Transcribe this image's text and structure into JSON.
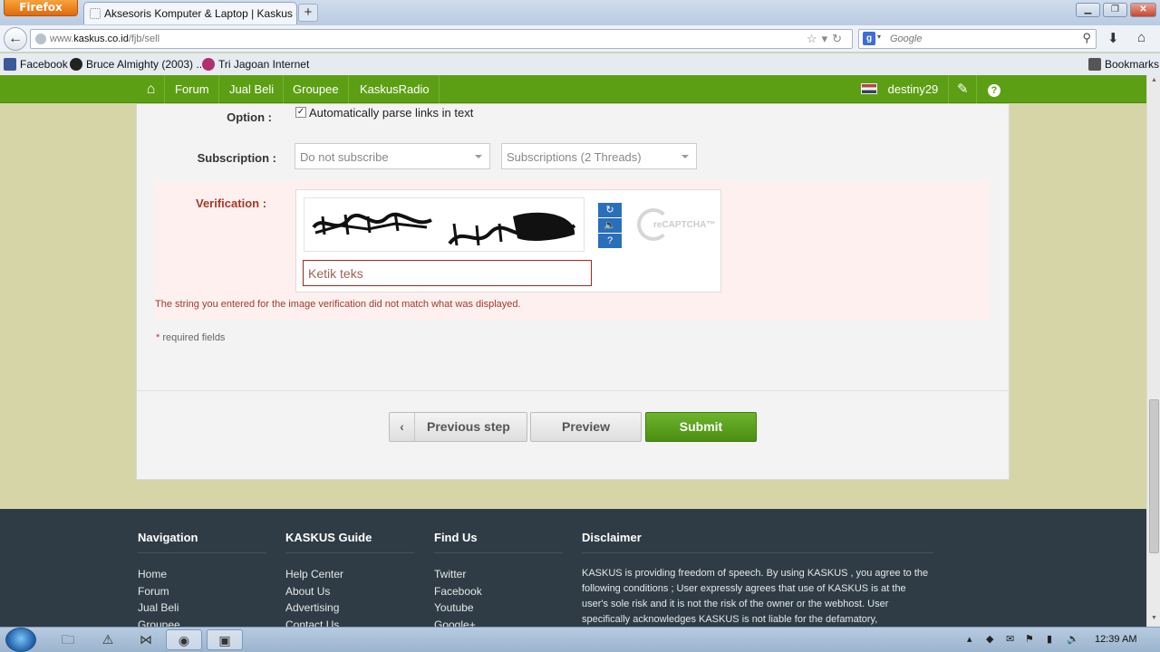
{
  "browser": {
    "menu_button": "Firefox",
    "tab_title": "Aksesoris Komputer & Laptop | Kaskus - ...",
    "new_tab": "+",
    "url_prefix": "www.",
    "url_host": "kaskus.co.id",
    "url_path": "/fjb/sell",
    "search_placeholder": "Google",
    "search_engine_letter": "g",
    "bookmarks": [
      {
        "label": "Facebook",
        "color": "#3b5998"
      },
      {
        "label": "Bruce Almighty (2003) ...",
        "color": "#222222"
      },
      {
        "label": "Tri Jagoan Internet",
        "color": "#b0306c"
      }
    ],
    "bookmarks_menu": "Bookmarks"
  },
  "kaskus_nav": {
    "items": [
      "Forum",
      "Jual Beli",
      "Groupee",
      "KaskusRadio"
    ],
    "username": "destiny29",
    "help": "?"
  },
  "form": {
    "option_label": "Option  :",
    "option_checkbox": "Automatically parse links in text",
    "subscription_label": "Subscription  :",
    "subscription_select": "Do not subscribe",
    "subscriptions_threads": "Subscriptions (2 Threads)",
    "verification_label": "Verification  :",
    "captcha_input_placeholder": "Ketik teks",
    "captcha_logo": "reCAPTCHA™",
    "error": "The string you entered for the image verification did not match what was displayed.",
    "required_star": "*",
    "required_text": " required fields"
  },
  "buttons": {
    "previous": "Previous step",
    "preview": "Preview",
    "submit": "Submit"
  },
  "footer": {
    "navigation": {
      "title": "Navigation",
      "links": [
        "Home",
        "Forum",
        "Jual Beli",
        "Groupee"
      ]
    },
    "guide": {
      "title": "KASKUS Guide",
      "links": [
        "Help Center",
        "About Us",
        "Advertising",
        "Contact Us"
      ]
    },
    "findus": {
      "title": "Find Us",
      "links": [
        "Twitter",
        "Facebook",
        "Youtube",
        "Google+"
      ]
    },
    "disclaimer": {
      "title": "Disclaimer",
      "text": "KASKUS is providing freedom of speech. By using KASKUS , you agree to the following conditions ; User expressly agrees that use of KASKUS is at the user's sole risk and it is not the risk of the owner or the webhost. User specifically acknowledges KASKUS is not liable for the defamatory,"
    }
  },
  "taskbar": {
    "clock": "12:39 AM"
  },
  "colors": {
    "kaskus_green": "#5d9f14",
    "error_red": "#a33a2b",
    "footer_bg": "#2f3c45"
  }
}
